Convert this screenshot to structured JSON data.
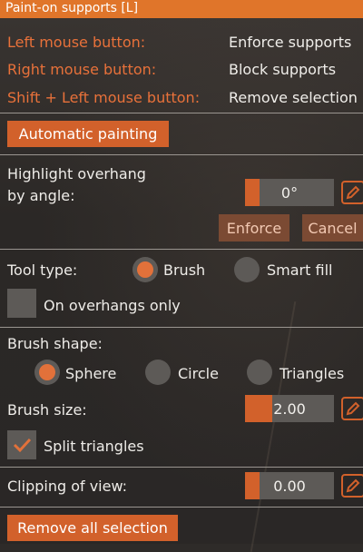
{
  "window": {
    "title": "Paint-on supports [L]"
  },
  "mouse_legend": [
    {
      "action": "Left mouse button:",
      "result": "Enforce supports"
    },
    {
      "action": "Right mouse button:",
      "result": "Block supports"
    },
    {
      "action": "Shift + Left mouse button:",
      "result": "Remove selection"
    }
  ],
  "auto_painting": {
    "label": "Automatic painting"
  },
  "overhang": {
    "label_line1": "Highlight overhang",
    "label_line2": "by angle:",
    "value": "0°",
    "fill": 0.0,
    "enforce_label": "Enforce",
    "cancel_label": "Cancel"
  },
  "tool_type": {
    "label": "Tool type:",
    "options": [
      "Brush",
      "Smart fill"
    ],
    "selected": "Brush"
  },
  "overhangs_only": {
    "label": "On overhangs only",
    "checked": false
  },
  "brush_shape": {
    "label": "Brush shape:",
    "options": [
      "Sphere",
      "Circle",
      "Triangles"
    ],
    "selected": "Sphere"
  },
  "brush_size": {
    "label": "Brush size:",
    "value": "2.00"
  },
  "split_triangles": {
    "label": "Split triangles",
    "checked": true
  },
  "clipping": {
    "label": "Clipping of view:",
    "value": "0.00"
  },
  "remove_all": {
    "label": "Remove all selection"
  },
  "colors": {
    "accent": "#d2612b",
    "label_orange": "#e8713a",
    "field": "#5d5a57"
  },
  "icons": [
    "edit-pencil-icon",
    "check-icon"
  ]
}
